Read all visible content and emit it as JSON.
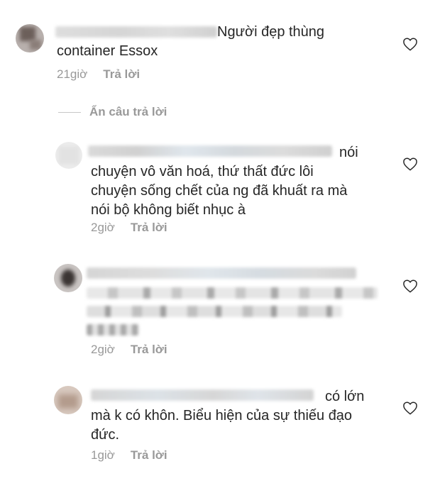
{
  "comments": [
    {
      "text_line1": "Người đẹp thùng",
      "text_line2": "container Essox",
      "time": "21giờ",
      "reply_label": "Trả lời"
    },
    {
      "text_line1": "nói",
      "text_line2": "chuyện vô văn hoá, thứ thất đức lôi",
      "text_line3": "chuyện sống chết của ng đã khuất ra mà",
      "text_line4": "nói bộ không biết nhục à",
      "time": "2giờ",
      "reply_label": "Trả lời"
    },
    {
      "time": "2giờ",
      "reply_label": "Trả lời"
    },
    {
      "text_line1": "có lớn",
      "text_line2": "mà k có khôn. Biểu hiện của sự thiếu đạo",
      "text_line3": "đức.",
      "time": "1giờ",
      "reply_label": "Trả lời"
    }
  ],
  "hide_replies_label": "Ẩn câu trả lời",
  "colors": {
    "meta_text": "#999999",
    "body_text": "#262626"
  }
}
